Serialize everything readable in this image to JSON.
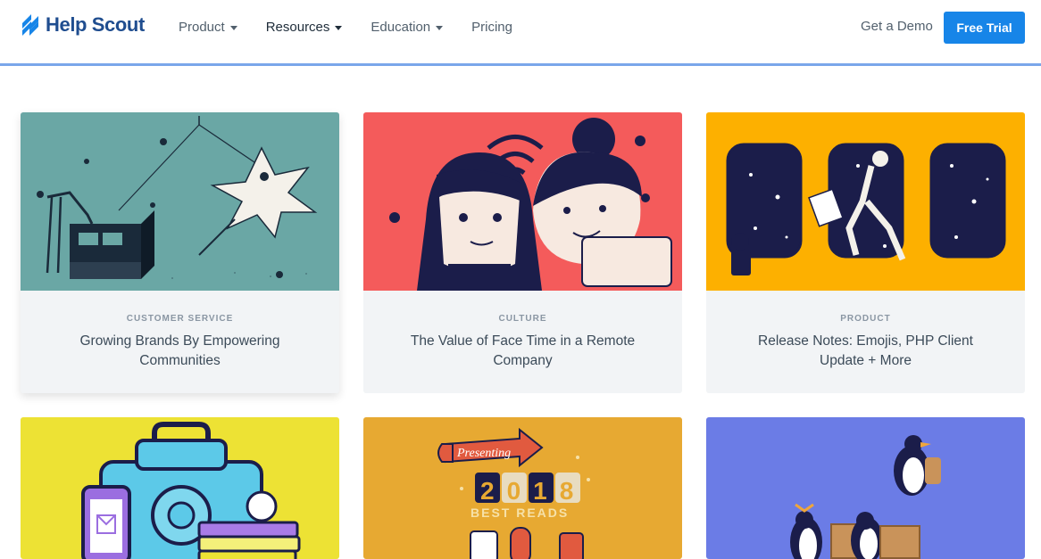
{
  "brand": {
    "name": "Help Scout",
    "accent": "#1785e8",
    "logo_color": "#1f4d8f"
  },
  "nav": {
    "items": [
      {
        "label": "Product",
        "has_dropdown": true
      },
      {
        "label": "Resources",
        "has_dropdown": true,
        "active": true
      },
      {
        "label": "Education",
        "has_dropdown": true
      },
      {
        "label": "Pricing",
        "has_dropdown": false
      }
    ],
    "demo_label": "Get a Demo",
    "trial_label": "Free Trial"
  },
  "cards": [
    {
      "category": "CUSTOMER SERVICE",
      "title": "Growing Brands By Empowering Communities",
      "bg": "#6aa7a5"
    },
    {
      "category": "CULTURE",
      "title": "The Value of Face Time in a Remote Company",
      "bg": "#f45b5b"
    },
    {
      "category": "PRODUCT",
      "title": "Release Notes: Emojis, PHP Client Update + More",
      "bg": "#fdb000"
    },
    {
      "bg": "#ede234"
    },
    {
      "bg": "#e7a932",
      "art_text": {
        "presenting": "Presenting",
        "year": "2018",
        "best_reads": "BEST READS"
      }
    },
    {
      "bg": "#6b7ce6"
    }
  ]
}
